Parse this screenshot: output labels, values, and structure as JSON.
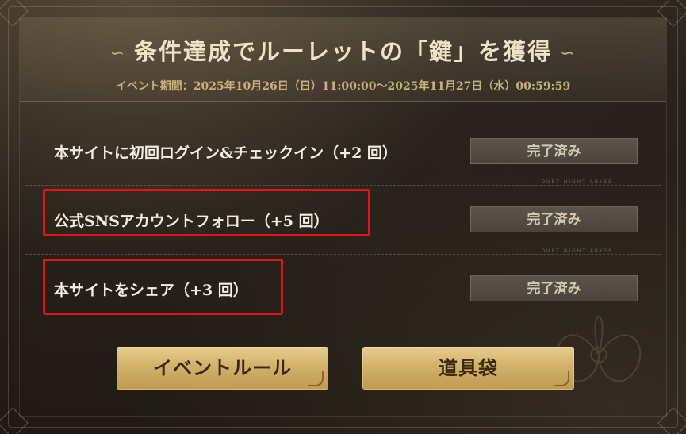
{
  "header": {
    "title": "条件達成でルーレットの「鍵」を獲得",
    "flourish_left": "∽",
    "flourish_right": "∽",
    "period": "イベント期間：2025年10月26日（日）11:00:00〜2025年11月27日（水）00:59:59"
  },
  "tasks": [
    {
      "label": "本サイトに初回ログイン&チェックイン（+2 回）",
      "status": "完了済み",
      "highlighted": false
    },
    {
      "label": "公式SNSアカウントフォロー（+5 回）",
      "status": "完了済み",
      "highlighted": true
    },
    {
      "label": "本サイトをシェア（+3 回）",
      "status": "完了済み",
      "highlighted": true
    }
  ],
  "divider_tag": "DUET NIGHT ABYSS",
  "buttons": {
    "event_rules": "イベントルール",
    "item_bag": "道具袋"
  },
  "colors": {
    "highlight": "#e01515",
    "gold": "#d2b26b",
    "title": "#efe2c9",
    "period": "#c9b07d"
  }
}
